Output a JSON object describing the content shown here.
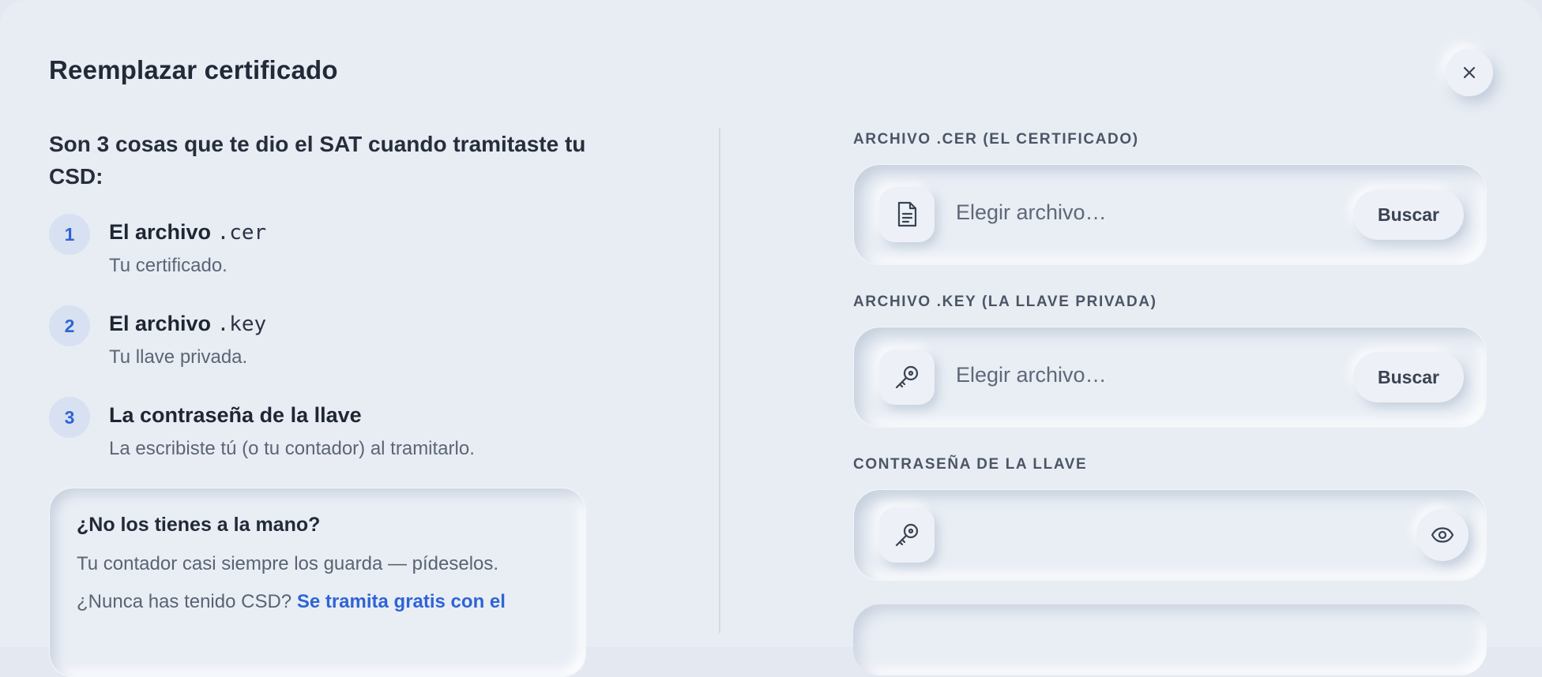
{
  "dialog": {
    "title": "Reemplazar certificado",
    "close_icon": "close-icon"
  },
  "intro": {
    "text": "Son 3 cosas que te dio el SAT cuando tramitaste tu CSD:"
  },
  "steps": [
    {
      "number": "1",
      "title_prefix": "El archivo ",
      "title_code": ".cer",
      "description": "Tu certificado."
    },
    {
      "number": "2",
      "title_prefix": "El archivo ",
      "title_code": ".key",
      "description": "Tu llave privada."
    },
    {
      "number": "3",
      "title": "La contraseña de la llave",
      "description": "La escribiste tú (o tu contador) al tramitarlo."
    }
  ],
  "help": {
    "title": "¿No los tienes a la mano?",
    "line1": "Tu contador casi siempre los guarda — pídeselos.",
    "line2_prefix": "¿Nunca has tenido CSD? ",
    "line2_link": "Se tramita gratis con el"
  },
  "fields": {
    "cer": {
      "label": "ARCHIVO .CER (EL CERTIFICADO)",
      "placeholder": "Elegir archivo…",
      "button": "Buscar",
      "icon": "document-icon"
    },
    "key": {
      "label": "ARCHIVO .KEY (LA LLAVE PRIVADA)",
      "placeholder": "Elegir archivo…",
      "button": "Buscar",
      "icon": "key-icon"
    },
    "password": {
      "label": "CONTRASEÑA DE LA LLAVE",
      "value": "",
      "icon": "key-icon",
      "toggle_icon": "eye-icon"
    }
  },
  "colors": {
    "background": "#e8edf4",
    "accent": "#2f64d6",
    "step_badge": "#d8e1f1",
    "text_primary": "#1f2633",
    "text_secondary": "#5c6575"
  }
}
